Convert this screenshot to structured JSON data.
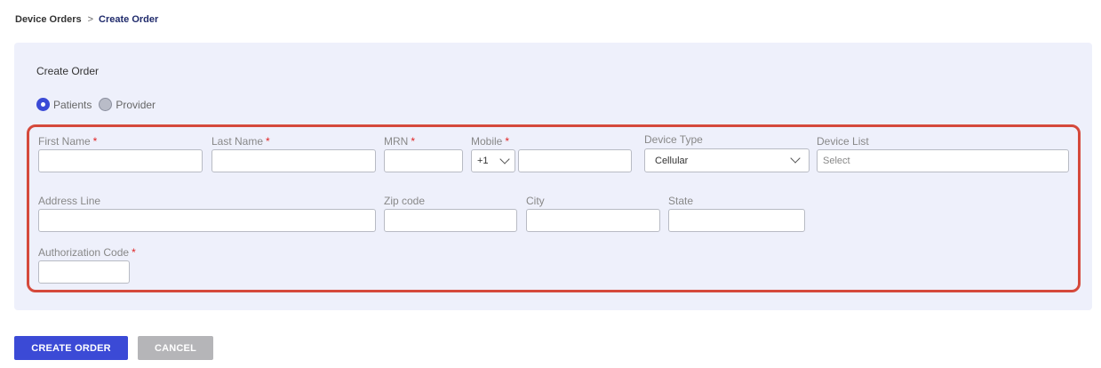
{
  "breadcrumb": {
    "parent": "Device Orders",
    "separator": ">",
    "current": "Create Order"
  },
  "card": {
    "title": "Create Order"
  },
  "recipient": {
    "options": [
      {
        "label": "Patients",
        "selected": true
      },
      {
        "label": "Provider",
        "selected": false
      }
    ]
  },
  "form": {
    "first_name": {
      "label": "First Name",
      "required_mark": "*",
      "value": ""
    },
    "last_name": {
      "label": "Last Name",
      "required_mark": "*",
      "value": ""
    },
    "mrn": {
      "label": "MRN",
      "required_mark": "*",
      "value": ""
    },
    "mobile": {
      "label": "Mobile",
      "required_mark": "*",
      "country_code": "+1",
      "value": ""
    },
    "device_type": {
      "label": "Device Type",
      "value": "Cellular"
    },
    "device_list": {
      "label": "Device List",
      "placeholder": "Select"
    },
    "address_line": {
      "label": "Address Line",
      "value": ""
    },
    "zip_code": {
      "label": "Zip code",
      "value": ""
    },
    "city": {
      "label": "City",
      "value": ""
    },
    "state": {
      "label": "State",
      "value": ""
    },
    "authorization_code": {
      "label": "Authorization Code",
      "required_mark": "*",
      "value": ""
    }
  },
  "actions": {
    "create_label": "CREATE ORDER",
    "cancel_label": "CANCEL"
  },
  "colors": {
    "primary": "#3b4ad6",
    "highlight_border": "#d5493b",
    "card_bg": "#eef0fb",
    "required": "#e02424",
    "cancel_bg": "#b5b5b8"
  }
}
